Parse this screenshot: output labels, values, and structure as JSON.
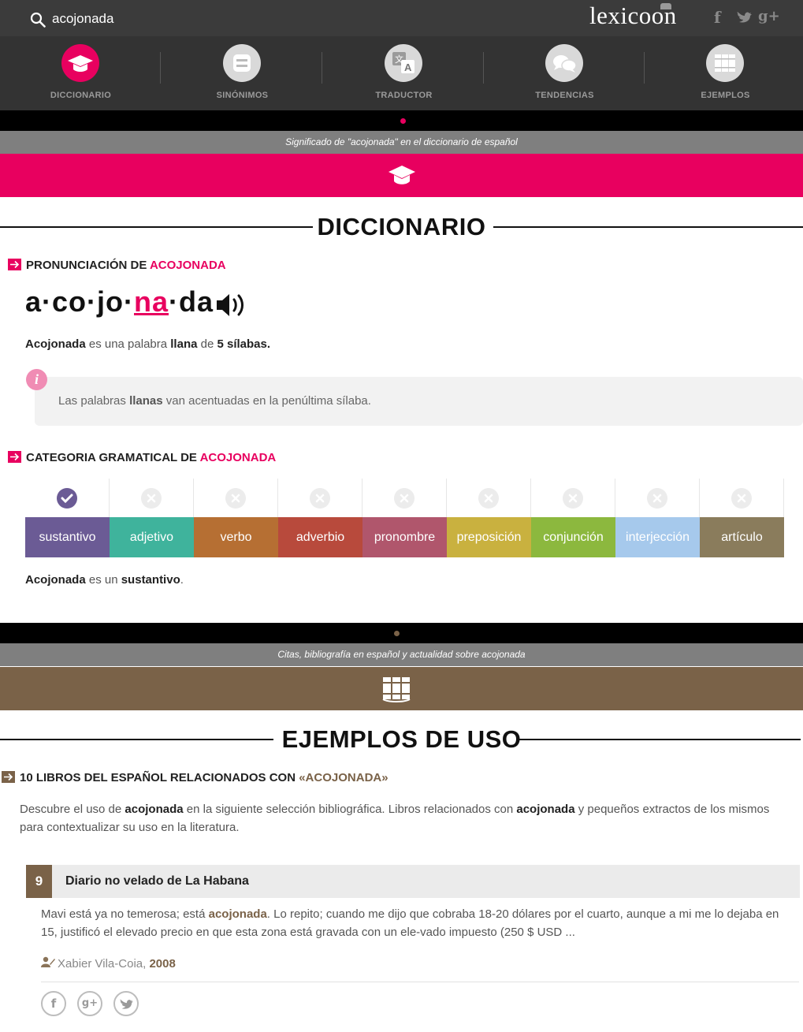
{
  "search": {
    "value": "acojonada"
  },
  "logo": "lexicoon",
  "social_top": [
    "f",
    "t",
    "g+"
  ],
  "nav": [
    {
      "label": "DICCIONARIO",
      "icon": "graduation-cap-icon",
      "active": true
    },
    {
      "label": "SINÓNIMOS",
      "icon": "equals-icon",
      "active": false
    },
    {
      "label": "TRADUCTOR",
      "icon": "translate-icon",
      "active": false
    },
    {
      "label": "TENDENCIAS",
      "icon": "speech-bubbles-icon",
      "active": false
    },
    {
      "label": "EJEMPLOS",
      "icon": "books-icon",
      "active": false
    }
  ],
  "colors": {
    "pink": "#e8005f",
    "brown": "#7a6248",
    "dark": "#333333"
  },
  "dictionary": {
    "subtitle": "Significado de \"acojonada\" en el diccionario de español",
    "title": "DICCIONARIO",
    "pron_heading": "PRONUNCIACIÓN DE",
    "word_upper": "ACOJONADA",
    "syllables_before": "a·co·jo·",
    "syllable_stress": "na",
    "syllables_after": "·da",
    "word": "Acojonada",
    "desc_1": " es una palabra ",
    "desc_type": "llana",
    "desc_2": " de ",
    "desc_count": "5 sílabas.",
    "info_1": "Las palabras ",
    "info_bold": "llanas",
    "info_2": " van acentuadas en la penúltima sílaba.",
    "cat_heading": "CATEGORIA GRAMATICAL DE",
    "categories": [
      {
        "label": "sustantivo",
        "color": "#6b5b95",
        "selected": true
      },
      {
        "label": "adjetivo",
        "color": "#3fb39c",
        "selected": false
      },
      {
        "label": "verbo",
        "color": "#b66f33",
        "selected": false
      },
      {
        "label": "adverbio",
        "color": "#b84a3c",
        "selected": false
      },
      {
        "label": "pronombre",
        "color": "#b0566c",
        "selected": false
      },
      {
        "label": "preposición",
        "color": "#c9b13f",
        "selected": false
      },
      {
        "label": "conjunción",
        "color": "#8cb83e",
        "selected": false
      },
      {
        "label": "interjección",
        "color": "#a6c9ec",
        "selected": false
      },
      {
        "label": "artículo",
        "color": "#8a7c5c",
        "selected": false
      }
    ],
    "is_1": " es un ",
    "is_type": "sustantivo",
    "is_end": "."
  },
  "examples": {
    "subtitle": "Citas, bibliografía en español y actualidad sobre acojonada",
    "title": "EJEMPLOS DE USO",
    "books_heading": "10 LIBROS DEL ESPAÑOL RELACIONADOS CON",
    "books_word": "«ACOJONADA»",
    "intro_1": "Descubre el uso de ",
    "intro_word": "acojonada",
    "intro_2": " en la siguiente selección bibliográfica. Libros relacionados con ",
    "intro_3": " y pequeños extractos de los mismos para contextualizar su uso en la literatura.",
    "book": {
      "number": "9",
      "title": "Diario no velado de La Habana",
      "excerpt_1": "Mavi está ya no temerosa; está ",
      "excerpt_word": "acojonada",
      "excerpt_2": ". Lo repito; cuando me dijo que cobraba 18-20 dólares por el cuarto, aunque a mi me lo dejaba en 15, justificó el elevado precio en que esta zona está gravada con un ele-vado impuesto (250 $ USD ...",
      "author": "Xabier Vila-Coia, ",
      "year": "2008"
    },
    "share": [
      "f",
      "g+",
      "t"
    ]
  }
}
